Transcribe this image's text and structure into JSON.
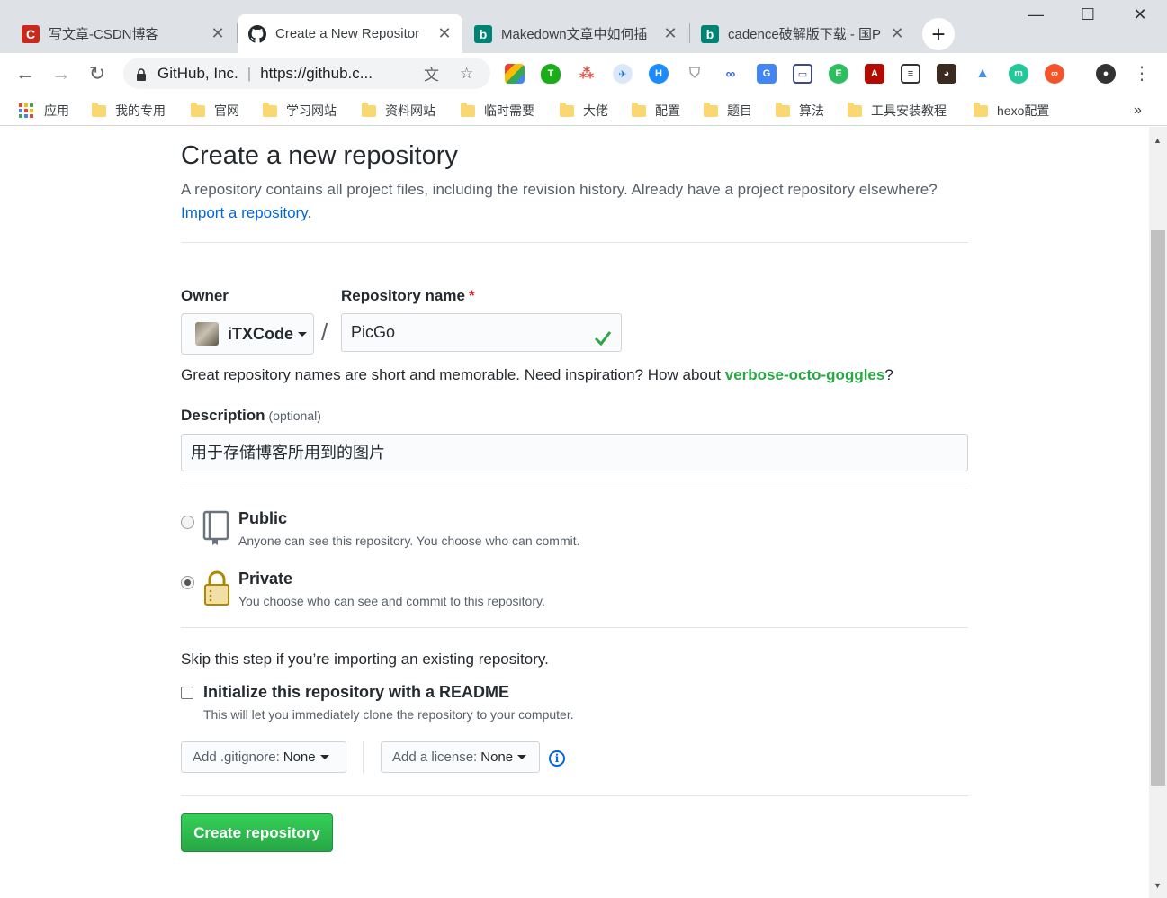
{
  "browser": {
    "tabs": [
      {
        "title": "写文章-CSDN博客",
        "icon": "csdn-icon",
        "color": "#c9281d"
      },
      {
        "title": "Create a New Repositor",
        "icon": "github-icon",
        "color": "#24292e"
      },
      {
        "title": "Makedown文章中如何插",
        "icon": "bing-icon",
        "color": "#008373"
      },
      {
        "title": "cadence破解版下载 - 国P",
        "icon": "bing-icon",
        "color": "#008373"
      }
    ],
    "omnibox": {
      "site": "GitHub, Inc.",
      "url": "https://github.c..."
    },
    "bookmarks": [
      {
        "label": "应用",
        "icon": "apps-icon"
      },
      {
        "label": "我的专用",
        "icon": "folder-icon"
      },
      {
        "label": "官网",
        "icon": "folder-icon"
      },
      {
        "label": "学习网站",
        "icon": "folder-icon"
      },
      {
        "label": "资料网站",
        "icon": "folder-icon"
      },
      {
        "label": "临时需要",
        "icon": "folder-icon"
      },
      {
        "label": "大佬",
        "icon": "folder-icon"
      },
      {
        "label": "配置",
        "icon": "folder-icon"
      },
      {
        "label": "题目",
        "icon": "folder-icon"
      },
      {
        "label": "算法",
        "icon": "folder-icon"
      },
      {
        "label": "工具安装教程",
        "icon": "folder-icon"
      },
      {
        "label": "hexo配置",
        "icon": "folder-icon"
      }
    ],
    "more_bookmarks": "»"
  },
  "page": {
    "title": "Create a new repository",
    "subtitle": "A repository contains all project files, including the revision history. Already have a project repository elsewhere?",
    "import_link": "Import a repository",
    "import_suffix": ".",
    "owner_label": "Owner",
    "owner_value": "iTXCode",
    "repo_label": "Repository name",
    "required_mark": "*",
    "slash": "/",
    "repo_value": "PicGo",
    "hint_prefix": "Great repository names are short and memorable. Need inspiration? How about ",
    "hint_suggestion": "verbose-octo-goggles",
    "hint_suffix": "?",
    "description_label": "Description",
    "description_optional": "(optional)",
    "description_value": "用于存储博客所用到的图片",
    "public_title": "Public",
    "public_desc": "Anyone can see this repository. You choose who can commit.",
    "private_title": "Private",
    "private_desc": "You choose who can see and commit to this repository.",
    "selected_visibility": "Private",
    "skip_text": "Skip this step if you’re importing an existing repository.",
    "readme_label": "Initialize this repository with a README",
    "readme_desc": "This will let you immediately clone the repository to your computer.",
    "gitignore_prefix": "Add .gitignore:",
    "gitignore_value": "None",
    "license_prefix": "Add a license:",
    "license_value": "None",
    "create_button": "Create repository",
    "colors": {
      "accent_link": "#0366d6",
      "primary_button": "#28a745",
      "suggestion": "#28a745"
    }
  }
}
